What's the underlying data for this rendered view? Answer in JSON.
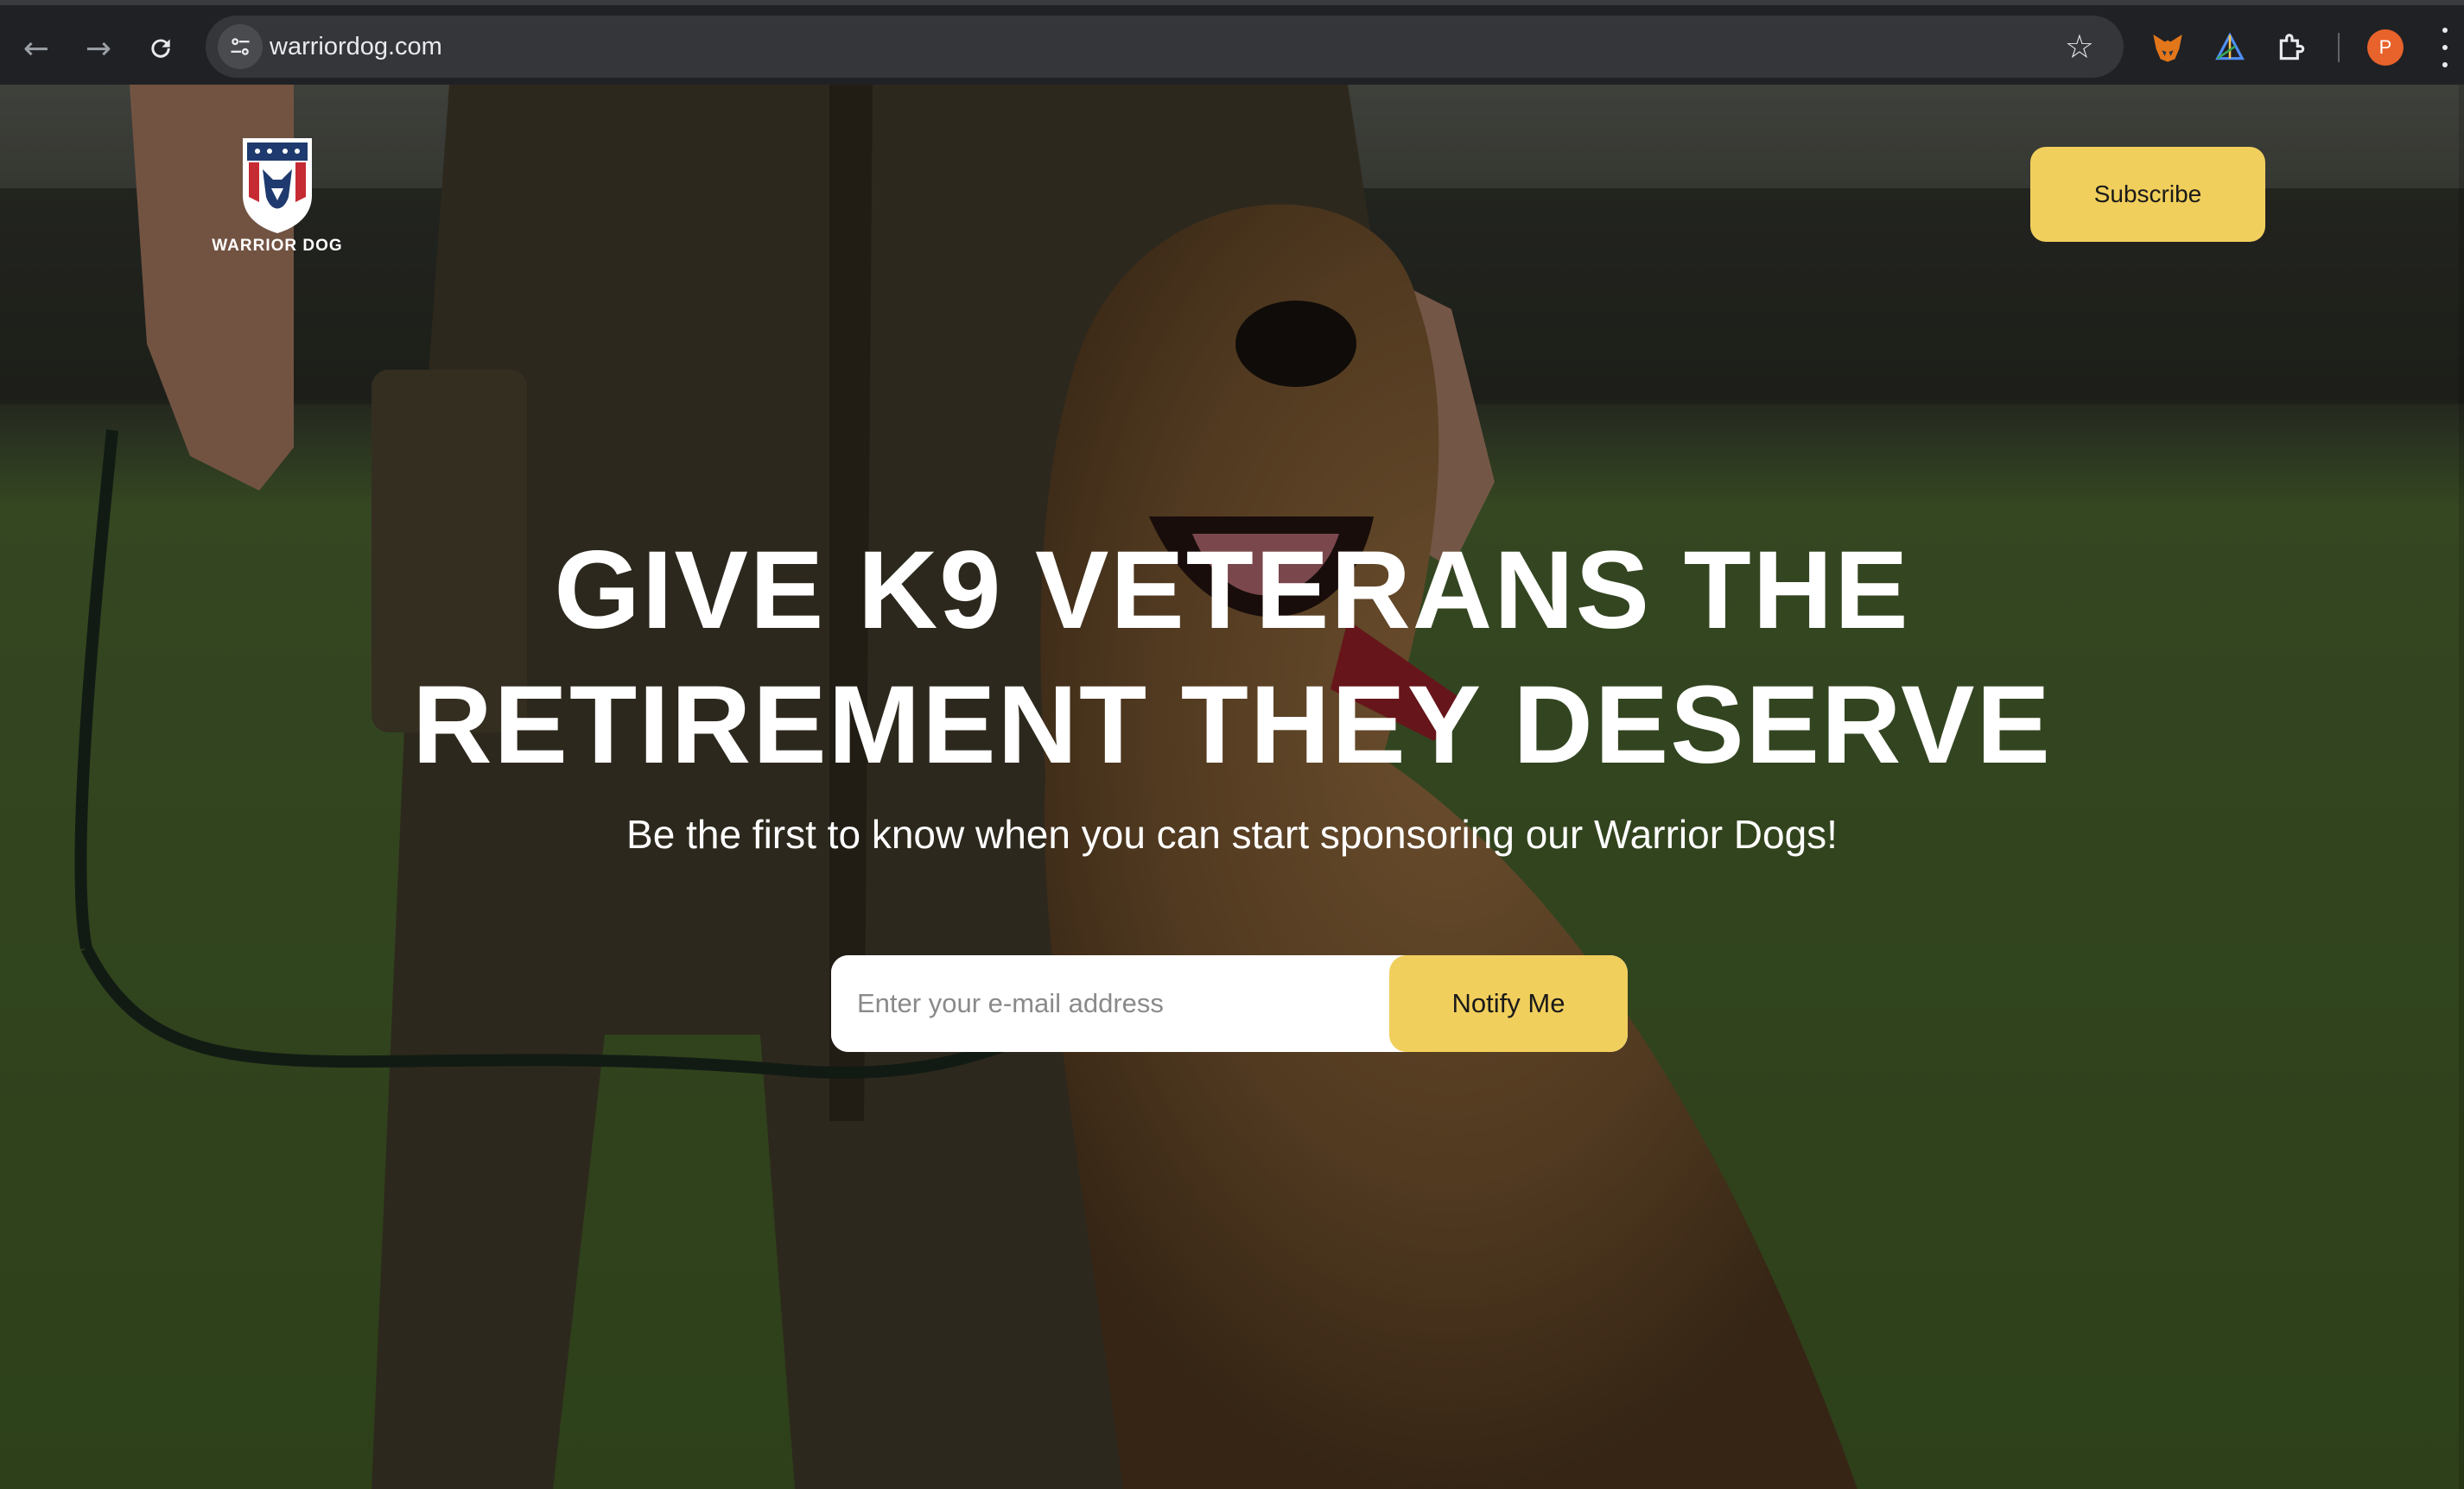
{
  "browser": {
    "url": "warriordog.com",
    "profile_initial": "P",
    "icons": {
      "back": "arrow-left-icon",
      "forward": "arrow-right-icon",
      "reload": "reload-icon",
      "site_info": "tune-icon",
      "bookmark": "star-icon",
      "extensions": [
        "fox-extension-icon",
        "triangle-extension-icon",
        "puzzle-icon"
      ],
      "menu": "vertical-dots-icon"
    }
  },
  "site": {
    "logo_text": "WARRIOR DOG",
    "subscribe_label": "Subscribe",
    "headline_line1": "GIVE K9 VETERANS THE",
    "headline_line2": "RETIREMENT THEY DESERVE",
    "subheadline": "Be the first to know when you can start sponsoring our Warrior Dogs!",
    "email_placeholder": "Enter your e-mail address",
    "notify_label": "Notify Me"
  },
  "colors": {
    "accent_yellow": "#f1cf5c",
    "logo_blue": "#1f3a6e",
    "logo_red": "#c62b34",
    "profile_orange": "#e8632b"
  }
}
